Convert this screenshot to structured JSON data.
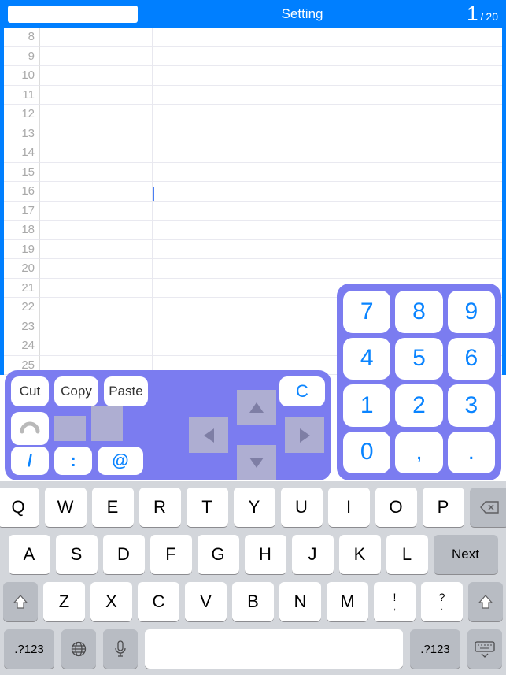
{
  "header": {
    "title": "Setting",
    "page_current": "1",
    "page_sep": "/",
    "page_total": "20"
  },
  "rows": [
    8,
    9,
    10,
    11,
    12,
    13,
    14,
    15,
    16,
    17,
    18,
    19,
    20,
    21,
    22,
    23,
    24,
    25
  ],
  "edit": {
    "cut": "Cut",
    "copy": "Copy",
    "paste": "Paste",
    "clear": "C",
    "slash": "/",
    "colon": ":",
    "at": "@"
  },
  "numpad": [
    [
      "7",
      "8",
      "9"
    ],
    [
      "4",
      "5",
      "6"
    ],
    [
      "1",
      "2",
      "3"
    ],
    [
      "0",
      ",",
      "."
    ]
  ],
  "kbd": {
    "r1": [
      "Q",
      "W",
      "E",
      "R",
      "T",
      "Y",
      "U",
      "I",
      "O",
      "P"
    ],
    "r2": [
      "A",
      "S",
      "D",
      "F",
      "G",
      "H",
      "J",
      "K",
      "L"
    ],
    "r3": [
      "Z",
      "X",
      "C",
      "V",
      "B",
      "N",
      "M"
    ],
    "punct1": {
      "top": "!",
      "bot": ","
    },
    "punct2": {
      "top": "?",
      "bot": "."
    },
    "next": "Next",
    "mode": ".?123"
  }
}
